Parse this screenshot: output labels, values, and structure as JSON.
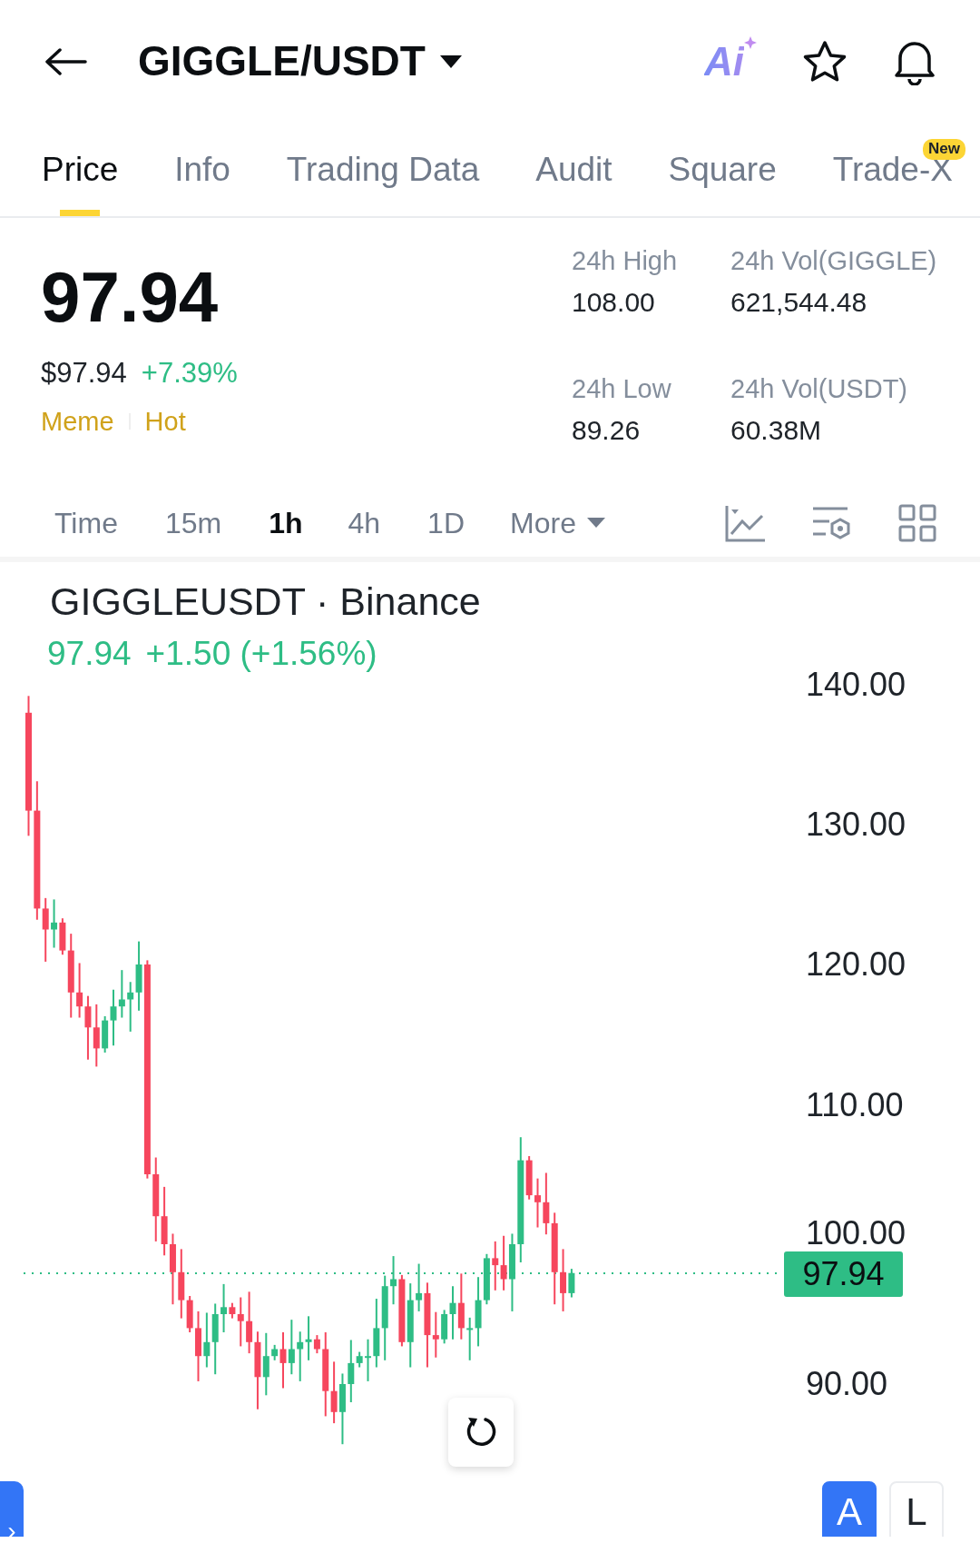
{
  "header": {
    "title": "GIGGLE/USDT",
    "ai_label": "Ai"
  },
  "tabs": [
    {
      "label": "Price",
      "selected": true
    },
    {
      "label": "Info",
      "selected": false
    },
    {
      "label": "Trading Data",
      "selected": false
    },
    {
      "label": "Audit",
      "selected": false
    },
    {
      "label": "Square",
      "selected": false
    },
    {
      "label": "Trade-X",
      "selected": false,
      "badge": "New"
    }
  ],
  "ticker": {
    "price": "97.94",
    "usd_price": "$97.94",
    "change": "+7.39%",
    "tags": [
      "Meme",
      "Hot"
    ],
    "stats": [
      {
        "label": "24h High",
        "value": "108.00"
      },
      {
        "label": "24h Vol(GIGGLE)",
        "value": "621,544.48"
      },
      {
        "label": "24h Low",
        "value": "89.26"
      },
      {
        "label": "24h Vol(USDT)",
        "value": "60.38M"
      }
    ]
  },
  "intervals": [
    {
      "label": "Time",
      "selected": false,
      "kind": "option"
    },
    {
      "label": "15m",
      "selected": false,
      "kind": "option"
    },
    {
      "label": "1h",
      "selected": true,
      "kind": "option"
    },
    {
      "label": "4h",
      "selected": false,
      "kind": "option"
    },
    {
      "label": "1D",
      "selected": false,
      "kind": "option"
    },
    {
      "label": "More",
      "selected": false,
      "kind": "dropdown"
    }
  ],
  "chart": {
    "title": "GIGGLEUSDT · Binance",
    "last": "97.94",
    "change": "+1.50 (+1.56%)",
    "y_axis_labels": [
      "140.00",
      "130.00",
      "120.00",
      "110.00",
      "100.00",
      "90.00"
    ],
    "price_tag": "97.94"
  },
  "bottom": {
    "drawer_tab": "›",
    "scale_buttons": [
      {
        "label": "A",
        "selected": true
      },
      {
        "label": "L",
        "selected": false
      }
    ]
  }
}
